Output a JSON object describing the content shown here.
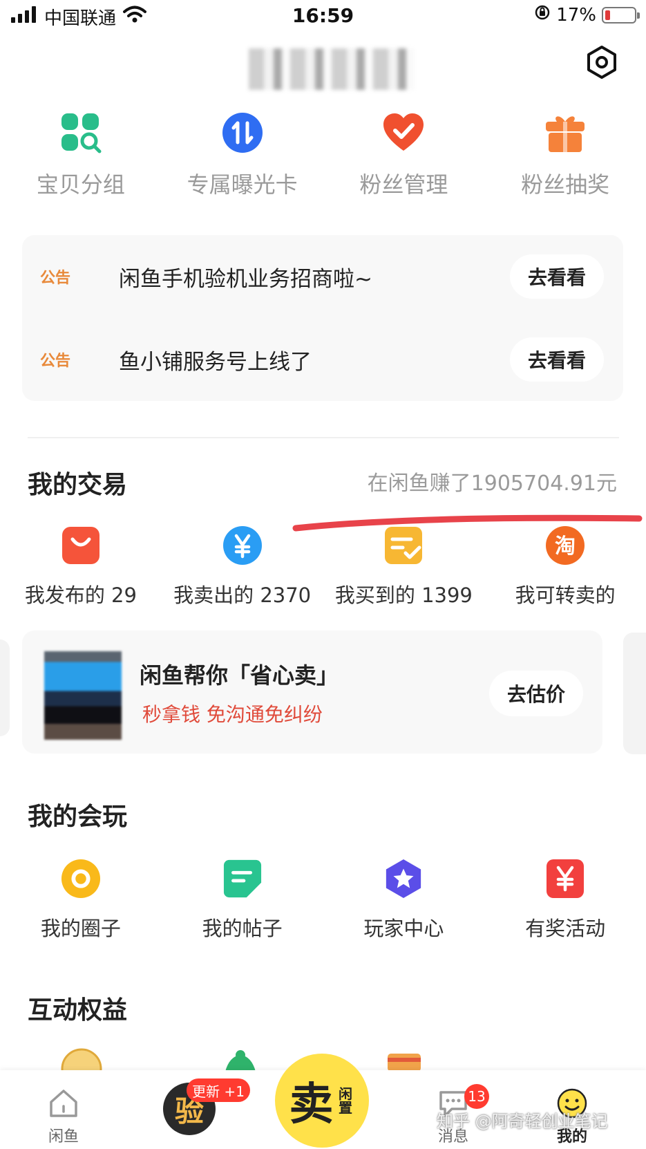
{
  "status_bar": {
    "carrier": "中国联通",
    "time": "16:59",
    "battery": "17%",
    "battery_level": 0.17
  },
  "tools": [
    {
      "label": "宝贝分组",
      "icon": "grid-search-icon",
      "color": "#29bd8a"
    },
    {
      "label": "专属曝光卡",
      "icon": "swap-arrows-icon",
      "color": "#2f6df2"
    },
    {
      "label": "粉丝管理",
      "icon": "heart-check-icon",
      "color": "#f0502f"
    },
    {
      "label": "粉丝抽奖",
      "icon": "gift-icon",
      "color": "#f5823a"
    }
  ],
  "notices": [
    {
      "tag": "公告",
      "text": "闲鱼手机验机业务招商啦~",
      "button": "去看看"
    },
    {
      "tag": "公告",
      "text": "鱼小铺服务号上线了",
      "button": "去看看"
    }
  ],
  "trade": {
    "title": "我的交易",
    "earned": "在闲鱼赚了1905704.91元",
    "items": [
      {
        "label": "我发布的 29",
        "icon": "shopping-bag-icon",
        "color": "#f5543a"
      },
      {
        "label": "我卖出的 2370",
        "icon": "yuan-coin-icon",
        "color": "#2a9df4"
      },
      {
        "label": "我买到的 1399",
        "icon": "order-check-icon",
        "color": "#f7b733"
      },
      {
        "label": "我可转卖的",
        "icon": "taobao-icon",
        "color": "#f26a22"
      }
    ]
  },
  "promo": {
    "title": "闲鱼帮你「省心卖」",
    "subtitle": "秒拿钱 免沟通免纠纷",
    "button": "去估价"
  },
  "play": {
    "title": "我的会玩",
    "items": [
      {
        "label": "我的圈子",
        "icon": "circle-icon",
        "color": "#f9b91a"
      },
      {
        "label": "我的帖子",
        "icon": "post-icon",
        "color": "#29c490"
      },
      {
        "label": "玩家中心",
        "icon": "star-badge-icon",
        "color": "#5b4ee8"
      },
      {
        "label": "有奖活动",
        "icon": "yuan-tag-icon",
        "color": "#f2403e"
      }
    ]
  },
  "benefits": {
    "title": "互动权益"
  },
  "nav": {
    "home": "闲鱼",
    "check_glyph": "验",
    "check_badge": "更新 +1",
    "sell_glyph": "卖",
    "sell_sub": "闲置",
    "messages": "消息",
    "messages_badge": "13",
    "mine": "我的"
  },
  "watermark": "知乎 @阿奇轻创业笔记"
}
